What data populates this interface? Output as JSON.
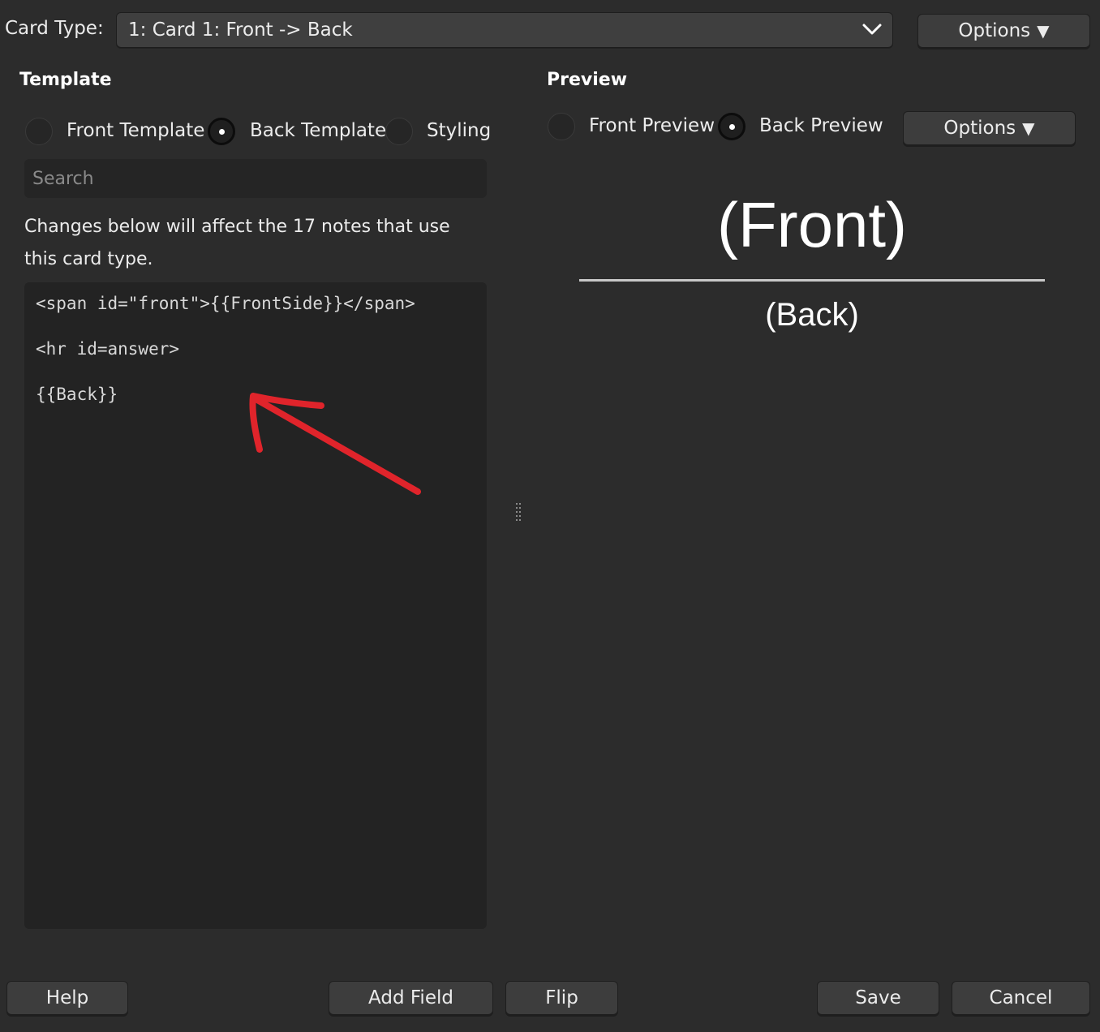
{
  "header": {
    "card_type_label": "Card Type:",
    "card_type_value": "1: Card 1: Front -> Back",
    "options_label": "Options"
  },
  "template": {
    "heading": "Template",
    "radios": [
      {
        "label": "Front Template",
        "checked": false
      },
      {
        "label": "Back Template",
        "checked": true
      },
      {
        "label": "Styling",
        "checked": false
      }
    ],
    "search_placeholder": "Search",
    "search_value": "",
    "note": "Changes below will affect the 17 notes that use this card type.",
    "code_lines": [
      "<span id=\"front\">{{FrontSide}}</span>",
      "<hr id=answer>",
      "{{Back}}"
    ]
  },
  "preview": {
    "heading": "Preview",
    "radios": [
      {
        "label": "Front Preview",
        "checked": false
      },
      {
        "label": "Back Preview",
        "checked": true
      }
    ],
    "options_label": "Options",
    "front_text": "(Front)",
    "back_text": "(Back)"
  },
  "footer": {
    "help_label": "Help",
    "add_field_label": "Add Field",
    "flip_label": "Flip",
    "save_label": "Save",
    "cancel_label": "Cancel"
  },
  "colors": {
    "background": "#2c2c2c",
    "annotation_arrow": "#e0242b"
  },
  "icons": {
    "card_type_dropdown": "chevron-down-icon",
    "options_dropdown": "triangle-down-icon",
    "splitter": "drag-handle-icon"
  }
}
